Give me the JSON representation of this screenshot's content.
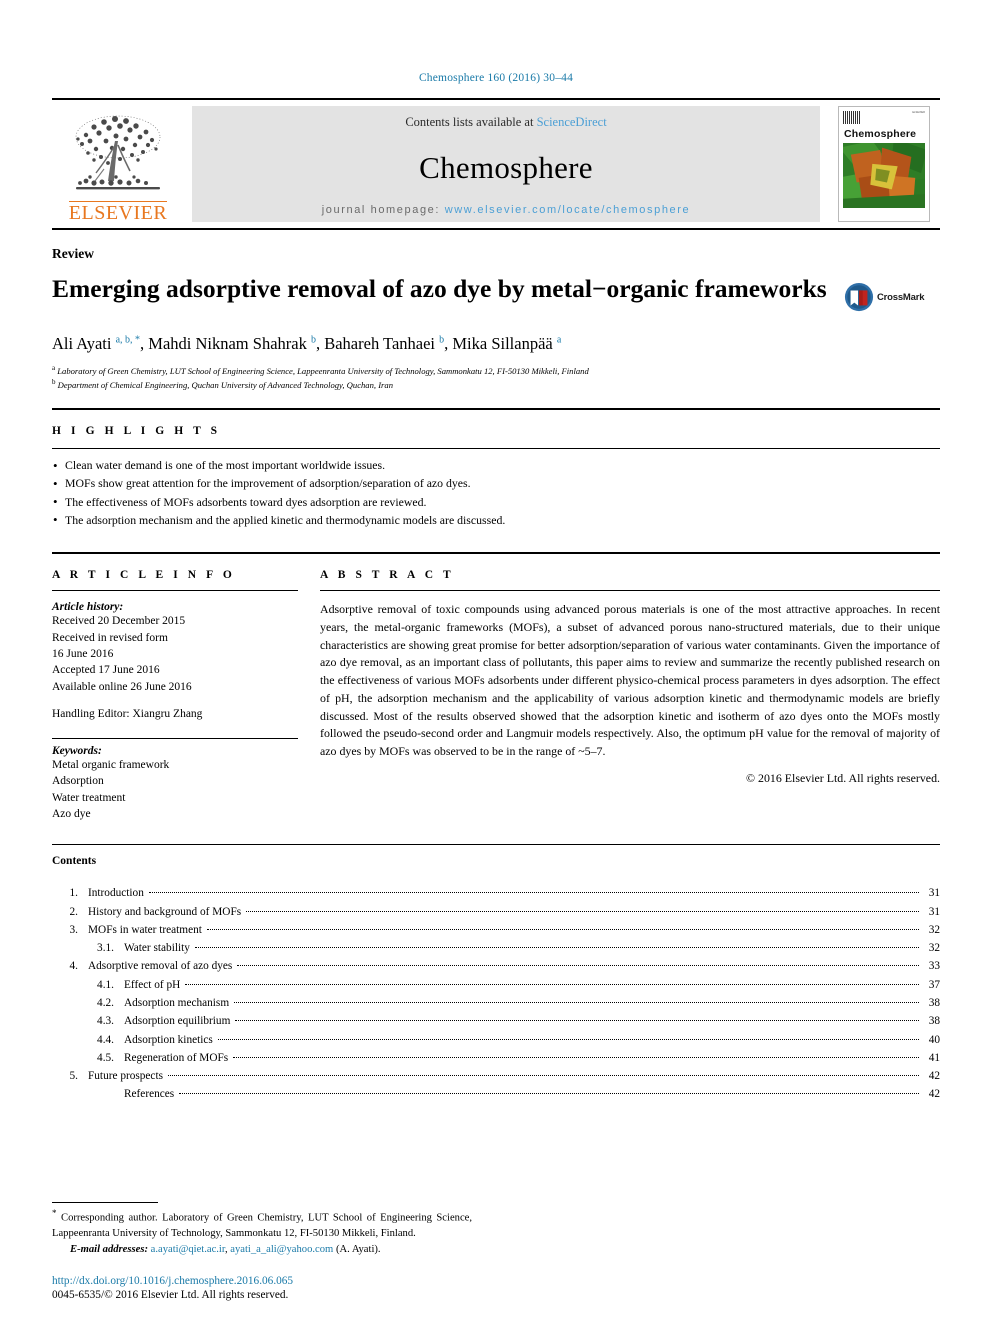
{
  "running_head": "Chemosphere 160 (2016) 30–44",
  "masthead": {
    "publisher": "ELSEVIER",
    "publisher_logo_icon": "elsevier-tree-logo",
    "contents_line_prefix": "Contents lists available at ",
    "contents_link": "ScienceDirect",
    "journal_name": "Chemosphere",
    "homepage_label": "journal homepage:",
    "homepage_url": "www.elsevier.com/locate/chemosphere",
    "cover": {
      "title": "Chemosphere",
      "barcode_icon": "barcode-icon",
      "corner_text": "ELSEVIER"
    },
    "accent_orange": "#e8771f",
    "link_blue": "#4b9fd5"
  },
  "article": {
    "type": "Review",
    "title": "Emerging adsorptive removal of azo dye by metal−organic frameworks",
    "crossmark_label": "CrossMark",
    "crossmark_icon": "crossmark-badge-icon",
    "authors": [
      {
        "name": "Ali Ayati",
        "marks": "a, b, *"
      },
      {
        "name": "Mahdi Niknam Shahrak",
        "marks": "b"
      },
      {
        "name": "Bahareh Tanhaei",
        "marks": "b"
      },
      {
        "name": "Mika Sillanpää",
        "marks": "a"
      }
    ],
    "affiliations": [
      {
        "mark": "a",
        "text": "Laboratory of Green Chemistry, LUT School of Engineering Science, Lappeenranta University of Technology, Sammonkatu 12, FI-50130 Mikkeli, Finland"
      },
      {
        "mark": "b",
        "text": "Department of Chemical Engineering, Quchan University of Advanced Technology, Quchan, Iran"
      }
    ]
  },
  "highlights": {
    "label": "H I G H L I G H T S",
    "items": [
      "Clean water demand is one of the most important worldwide issues.",
      "MOFs show great attention for the improvement of adsorption/separation of azo dyes.",
      "The effectiveness of MOFs adsorbents toward dyes adsorption are reviewed.",
      "The adsorption mechanism and the applied kinetic and thermodynamic models are discussed."
    ]
  },
  "article_info": {
    "label": "A R T I C L E   I N F O",
    "history_title": "Article history:",
    "history": [
      "Received 20 December 2015",
      "Received in revised form",
      "16 June 2016",
      "Accepted 17 June 2016",
      "Available online 26 June 2016"
    ],
    "handling_editor": "Handling Editor: Xiangru Zhang",
    "keywords_title": "Keywords:",
    "keywords": [
      "Metal organic framework",
      "Adsorption",
      "Water treatment",
      "Azo dye"
    ]
  },
  "abstract": {
    "label": "A B S T R A C T",
    "text": "Adsorptive removal of toxic compounds using advanced porous materials is one of the most attractive approaches. In recent years, the metal-organic frameworks (MOFs), a subset of advanced porous nano-structured materials, due to their unique characteristics are showing great promise for better adsorption/separation of various water contaminants. Given the importance of azo dye removal, as an important class of pollutants, this paper aims to review and summarize the recently published research on the effectiveness of various MOFs adsorbents under different physico-chemical process parameters in dyes adsorption. The effect of pH, the adsorption mechanism and the applicability of various adsorption kinetic and thermodynamic models are briefly discussed. Most of the results observed showed that the adsorption kinetic and isotherm of azo dyes onto the MOFs mostly followed the pseudo-second order and Langmuir models respectively. Also, the optimum pH value for the removal of majority of azo dyes by MOFs was observed to be in the range of ~5–7.",
    "copyright": "© 2016 Elsevier Ltd. All rights reserved."
  },
  "contents": {
    "title": "Contents",
    "entries": [
      {
        "num": "1.",
        "label": "Introduction",
        "page": "31",
        "sub": false
      },
      {
        "num": "2.",
        "label": "History and background of MOFs",
        "page": "31",
        "sub": false
      },
      {
        "num": "3.",
        "label": "MOFs in water treatment",
        "page": "32",
        "sub": false
      },
      {
        "num": "3.1.",
        "label": "Water stability",
        "page": "32",
        "sub": true
      },
      {
        "num": "4.",
        "label": "Adsorptive removal of azo dyes",
        "page": "33",
        "sub": false
      },
      {
        "num": "4.1.",
        "label": "Effect of pH",
        "page": "37",
        "sub": true
      },
      {
        "num": "4.2.",
        "label": "Adsorption mechanism",
        "page": "38",
        "sub": true
      },
      {
        "num": "4.3.",
        "label": "Adsorption equilibrium",
        "page": "38",
        "sub": true
      },
      {
        "num": "4.4.",
        "label": "Adsorption kinetics",
        "page": "40",
        "sub": true
      },
      {
        "num": "4.5.",
        "label": "Regeneration of MOFs",
        "page": "41",
        "sub": true
      },
      {
        "num": "5.",
        "label": "Future prospects",
        "page": "42",
        "sub": false
      },
      {
        "num": "",
        "label": "References",
        "page": "42",
        "sub": true
      }
    ]
  },
  "footnotes": {
    "corresponding": "Corresponding author. Laboratory of Green Chemistry, LUT School of Engineering Science, Lappeenranta University of Technology, Sammonkatu 12, FI-50130 Mikkeli, Finland.",
    "email_label": "E-mail addresses:",
    "email_1": "a.ayati@qiet.ac.ir",
    "email_2": "ayati_a_ali@yahoo.com",
    "email_owner": "(A. Ayati).",
    "doi": "http://dx.doi.org/10.1016/j.chemosphere.2016.06.065",
    "issn": "0045-6535/© 2016 Elsevier Ltd. All rights reserved."
  }
}
